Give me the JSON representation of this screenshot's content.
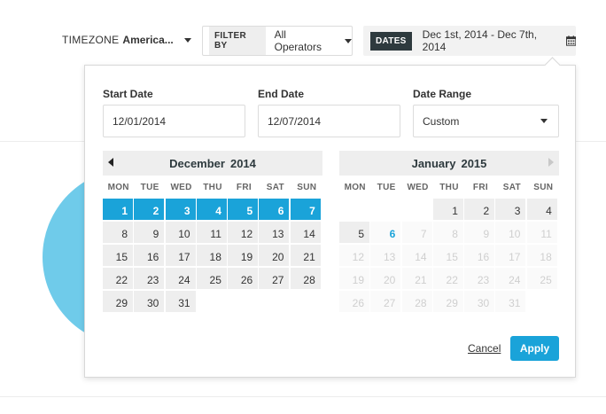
{
  "toolbar": {
    "timezone_label": "TIMEZONE",
    "timezone_value": "America...",
    "filter_tag": "FILTER BY",
    "filter_value": "All Operators",
    "dates_tag": "DATES",
    "dates_value": "Dec 1st, 2014 - Dec 7th, 2014"
  },
  "picker": {
    "start_label": "Start Date",
    "start_value": "12/01/2014",
    "end_label": "End Date",
    "end_value": "12/07/2014",
    "range_label": "Date Range",
    "range_value": "Custom",
    "weekdays": [
      "MON",
      "TUE",
      "WED",
      "THU",
      "FRI",
      "SAT",
      "SUN"
    ],
    "left_month": {
      "month": "December",
      "year": "2014"
    },
    "right_month": {
      "month": "January",
      "year": "2015"
    },
    "left_days": [
      [
        "1",
        "sel"
      ],
      [
        "2",
        "sel"
      ],
      [
        "3",
        "sel"
      ],
      [
        "4",
        "sel"
      ],
      [
        "5",
        "sel"
      ],
      [
        "6",
        "sel"
      ],
      [
        "7",
        "sel"
      ],
      [
        "8",
        ""
      ],
      [
        "9",
        ""
      ],
      [
        "10",
        ""
      ],
      [
        "11",
        ""
      ],
      [
        "12",
        ""
      ],
      [
        "13",
        ""
      ],
      [
        "14",
        ""
      ],
      [
        "15",
        ""
      ],
      [
        "16",
        ""
      ],
      [
        "17",
        ""
      ],
      [
        "18",
        ""
      ],
      [
        "19",
        ""
      ],
      [
        "20",
        ""
      ],
      [
        "21",
        ""
      ],
      [
        "22",
        ""
      ],
      [
        "23",
        ""
      ],
      [
        "24",
        ""
      ],
      [
        "25",
        ""
      ],
      [
        "26",
        ""
      ],
      [
        "27",
        ""
      ],
      [
        "28",
        ""
      ],
      [
        "29",
        ""
      ],
      [
        "30",
        ""
      ],
      [
        "31",
        ""
      ],
      [
        "",
        "empty"
      ],
      [
        "",
        "empty"
      ],
      [
        "",
        "empty"
      ],
      [
        "",
        "empty"
      ]
    ],
    "right_days": [
      [
        "",
        "empty"
      ],
      [
        "",
        "empty"
      ],
      [
        "",
        "empty"
      ],
      [
        "1",
        ""
      ],
      [
        "2",
        ""
      ],
      [
        "3",
        ""
      ],
      [
        "4",
        ""
      ],
      [
        "5",
        ""
      ],
      [
        "6",
        "today"
      ],
      [
        "7",
        "muted"
      ],
      [
        "8",
        "muted"
      ],
      [
        "9",
        "muted"
      ],
      [
        "10",
        "muted"
      ],
      [
        "11",
        "muted"
      ],
      [
        "12",
        "muted"
      ],
      [
        "13",
        "muted"
      ],
      [
        "14",
        "muted"
      ],
      [
        "15",
        "muted"
      ],
      [
        "16",
        "muted"
      ],
      [
        "17",
        "muted"
      ],
      [
        "18",
        "muted"
      ],
      [
        "19",
        "muted"
      ],
      [
        "20",
        "muted"
      ],
      [
        "21",
        "muted"
      ],
      [
        "22",
        "muted"
      ],
      [
        "23",
        "muted"
      ],
      [
        "24",
        "muted"
      ],
      [
        "25",
        "muted"
      ],
      [
        "26",
        "muted"
      ],
      [
        "27",
        "muted"
      ],
      [
        "28",
        "muted"
      ],
      [
        "29",
        "muted"
      ],
      [
        "30",
        "muted"
      ],
      [
        "31",
        "muted"
      ],
      [
        "",
        "empty"
      ]
    ],
    "cancel_label": "Cancel",
    "apply_label": "Apply"
  },
  "icons": {
    "calendar": "calendar-icon",
    "caret": "caret-down-icon"
  },
  "colors": {
    "accent": "#1aa3d9",
    "dark_tag": "#2e3a3e",
    "decor_circle": "#6fcbea"
  }
}
